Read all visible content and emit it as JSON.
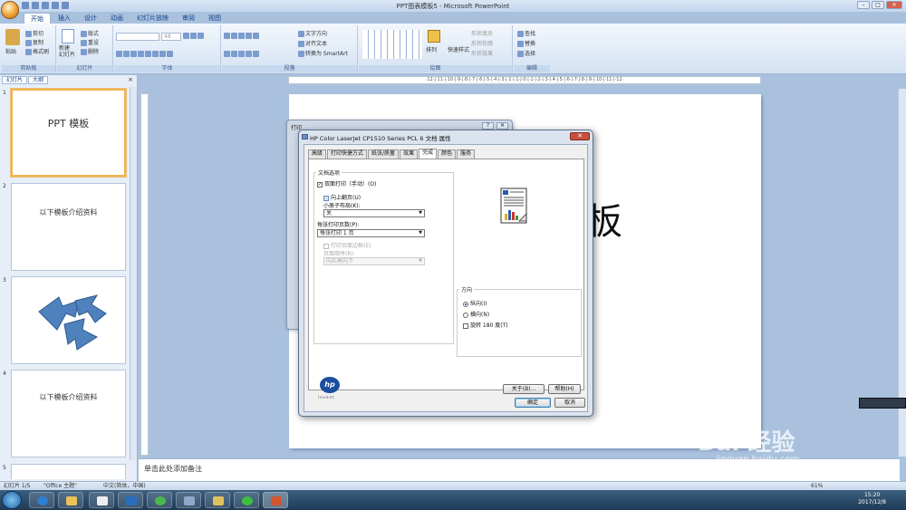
{
  "window": {
    "title": "PPT图表模板5 - Microsoft PowerPoint",
    "controls": [
      "–",
      "□",
      "✕"
    ]
  },
  "ribbon": {
    "tabs": [
      "开始",
      "插入",
      "设计",
      "动画",
      "幻灯片放映",
      "审阅",
      "视图"
    ],
    "clipboard": {
      "label": "剪贴板",
      "paste": "粘贴",
      "cut": "剪切",
      "copy": "复制",
      "format_painter": "格式刷"
    },
    "slides": {
      "label": "幻灯片",
      "new_slide": "新建\n幻灯片",
      "layout": "版式",
      "reset": "重设",
      "delete": "删除"
    },
    "font": {
      "label": "字体",
      "size": "48"
    },
    "paragraph": {
      "label": "段落",
      "text_direction": "文字方向",
      "align_text": "对齐文本",
      "smartart": "转换为 SmartArt"
    },
    "drawing": {
      "label": "绘图",
      "arrange": "排列",
      "quick_styles": "快速样式",
      "shape_fill": "形状填充",
      "shape_outline": "形状轮廓",
      "shape_effects": "形状效果"
    },
    "editing": {
      "label": "编辑",
      "find": "查找",
      "replace": "替换",
      "select": "选择"
    }
  },
  "panel": {
    "tabs": [
      "幻灯片",
      "大纲"
    ],
    "close": "×",
    "slides": [
      {
        "num": "1",
        "text": "PPT 模板"
      },
      {
        "num": "2",
        "text": "以下模板介绍资料"
      },
      {
        "num": "3",
        "text": ""
      },
      {
        "num": "4",
        "text": "以下模板介绍资料"
      },
      {
        "num": "5",
        "text": ""
      }
    ]
  },
  "ruler": "·12·|·11·|·10·|·9·|·8·|·7·|·6·|·5·|·4·|·3·|·2·|·1·|·0·|·1·|·2·|·3·|·4·|·5·|·6·|·7·|·8·|·9·|·10·|·11·|·12·",
  "slide": {
    "partial_title": "板"
  },
  "notes": "单击此处添加备注",
  "status": {
    "slide": "幻灯片 1/5",
    "theme": "\"Office 主题\"",
    "lang": "中文(简体，中国)",
    "zoom": "61%"
  },
  "bg_dialog": {
    "title": "打印",
    "controls": [
      "?",
      "✕"
    ]
  },
  "dialog": {
    "title": "HP Color LaserJet CP1510 Series PCL 6 文档 属性",
    "close": "✕",
    "tabs": [
      "高级",
      "打印快捷方式",
      "纸张/质量",
      "效果",
      "完成",
      "颜色",
      "服务"
    ],
    "doc_options": {
      "title": "文档选项",
      "duplex": "双面打印（手动）(O)",
      "flip_up": "向上翻页(U)",
      "booklet_label": "小册子布局(K):",
      "booklet_value": "关",
      "pages_per_sheet_label": "每张打印页数(P):",
      "pages_per_sheet_value": "每张打印 1 页",
      "print_borders": "打印页面边框(E)",
      "page_order_label": "页面顺序(R):",
      "page_order_value": "向右再向下"
    },
    "orientation": {
      "title": "方向",
      "portrait": "纵向(I)",
      "landscape": "横向(N)",
      "rotate": "旋转 180 度(T)"
    },
    "hp_logo": "hp",
    "hp_sub": "invent",
    "about": "关于(B)...",
    "help": "帮助(H)",
    "ok": "确定",
    "cancel": "取消"
  },
  "taskbar": {
    "time": "15:20",
    "date": "2017/12/8"
  },
  "watermark": {
    "brand": "Bai 经验",
    "url": "jingyan.baidu.com"
  }
}
